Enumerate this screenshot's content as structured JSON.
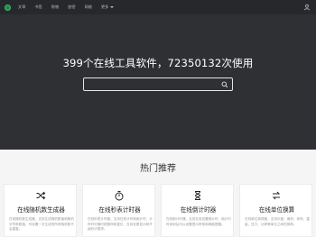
{
  "nav": {
    "items": [
      "文章",
      "书签",
      "购物",
      "加密",
      "网络"
    ],
    "more_label": "更多"
  },
  "hero": {
    "title": "399个在线工具软件，72350132次使用",
    "search_value": ""
  },
  "section": {
    "title": "热门推荐"
  },
  "cards": [
    {
      "title": "在线随机数生成器",
      "icon": "shuffle-icon",
      "desc": "在线随机数生成器，支持生成随机数值和随机字符串数值，可设置一次生成的所有随机数不会重复。"
    },
    {
      "title": "在线秒表计时器",
      "icon": "stopwatch-icon",
      "desc": "在线秒表计时器，支持在线计时和倒计时，计时时可随时按暂停和复位，支持全屏显示和开始秒计暂停。"
    },
    {
      "title": "在线倒计时器",
      "icon": "hourglass-icon",
      "desc": "在线倒计时器，支持在线设置倒计时，倒计时时间到后可以设置提示声音和弹窗提醒。"
    },
    {
      "title": "在线单位换算",
      "icon": "unit-convert-icon",
      "desc": "在线单位换算器，支持长度、面积、体积、重量、压力、功率等单位之间的换算。"
    }
  ],
  "colors": {
    "navbar": "#26282c",
    "hero": "#2f3034",
    "accent": "#1f8a4c"
  }
}
